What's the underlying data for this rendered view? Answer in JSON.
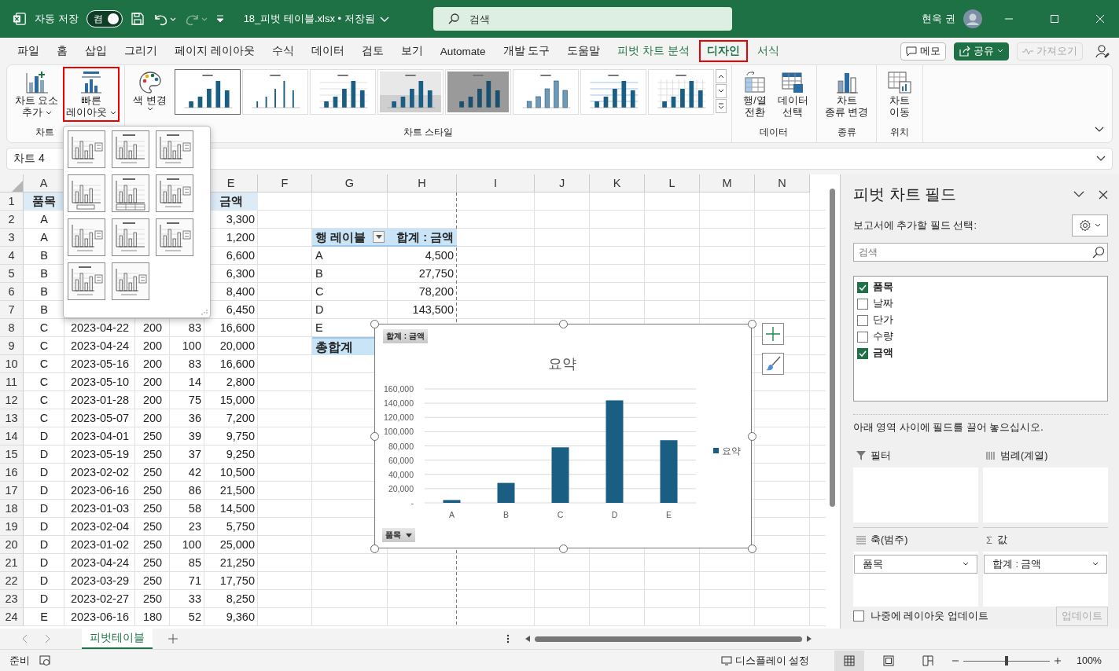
{
  "title_bar": {
    "autosave_label": "자동 저장",
    "autosave_state": "켬",
    "autosave_on": true,
    "redo_disabled": true,
    "filename": "18_피벗 테이블.xlsx • 저장됨",
    "search_placeholder": "검색",
    "user_name": "현욱 권"
  },
  "menu_tabs": [
    {
      "label": "파일",
      "selected": false,
      "contextual": false,
      "highlighted": false
    },
    {
      "label": "홈",
      "selected": false,
      "contextual": false,
      "highlighted": false
    },
    {
      "label": "삽입",
      "selected": false,
      "contextual": false,
      "highlighted": false
    },
    {
      "label": "그리기",
      "selected": false,
      "contextual": false,
      "highlighted": false
    },
    {
      "label": "페이지 레이아웃",
      "selected": false,
      "contextual": false,
      "highlighted": false
    },
    {
      "label": "수식",
      "selected": false,
      "contextual": false,
      "highlighted": false
    },
    {
      "label": "데이터",
      "selected": false,
      "contextual": false,
      "highlighted": false
    },
    {
      "label": "검토",
      "selected": false,
      "contextual": false,
      "highlighted": false
    },
    {
      "label": "보기",
      "selected": false,
      "contextual": false,
      "highlighted": false
    },
    {
      "label": "Automate",
      "selected": false,
      "contextual": false,
      "highlighted": false
    },
    {
      "label": "개발 도구",
      "selected": false,
      "contextual": false,
      "highlighted": false
    },
    {
      "label": "도움말",
      "selected": false,
      "contextual": false,
      "highlighted": false
    },
    {
      "label": "피벗 차트 분석",
      "selected": false,
      "contextual": true,
      "highlighted": false
    },
    {
      "label": "디자인",
      "selected": true,
      "contextual": true,
      "highlighted": true
    },
    {
      "label": "서식",
      "selected": false,
      "contextual": true,
      "highlighted": false
    }
  ],
  "tab_actions": {
    "comments": "메모",
    "share": "공유",
    "catch_up": "가져오기",
    "catch_up_disabled": true
  },
  "ribbon": [
    {
      "kind": "buttons",
      "label": "차트",
      "buttons": [
        {
          "lines": [
            "차트 요소",
            "추가"
          ],
          "dropdown": true,
          "highlighted": false
        },
        {
          "lines": [
            "빠른",
            "레이아웃"
          ],
          "dropdown": true,
          "highlighted": true
        }
      ]
    },
    {
      "kind": "gallery",
      "label": "차트 스타일",
      "buttons": [
        {
          "lines": [
            "색 변경"
          ],
          "dropdown": true,
          "highlighted": false
        }
      ],
      "styles": [
        {
          "kind": "plain",
          "selected": true
        },
        {
          "kind": "slim",
          "selected": false
        },
        {
          "kind": "striped",
          "selected": false
        },
        {
          "kind": "shadow",
          "selected": false
        },
        {
          "kind": "dark",
          "selected": false
        },
        {
          "kind": "outlined",
          "selected": false
        },
        {
          "kind": "gridded",
          "selected": false
        },
        {
          "kind": "hatched",
          "selected": false
        }
      ]
    },
    {
      "kind": "buttons",
      "label": "데이터",
      "buttons": [
        {
          "lines": [
            "행/열",
            "전환"
          ],
          "dropdown": false,
          "highlighted": false
        },
        {
          "lines": [
            "데이터",
            "선택"
          ],
          "dropdown": false,
          "highlighted": false
        }
      ]
    },
    {
      "kind": "buttons",
      "label": "종류",
      "buttons": [
        {
          "lines": [
            "차트",
            "종류 변경"
          ],
          "dropdown": false,
          "highlighted": false
        }
      ]
    },
    {
      "kind": "buttons",
      "label": "위치",
      "buttons": [
        {
          "lines": [
            "차트",
            "이동"
          ],
          "dropdown": false,
          "highlighted": false
        }
      ]
    }
  ],
  "name_box": "차트 4",
  "quick_layouts": [
    {
      "kind": "legend-right"
    },
    {
      "kind": "title"
    },
    {
      "kind": "title-legend-right"
    },
    {
      "kind": "legend-bottom"
    },
    {
      "kind": "title-table"
    },
    {
      "kind": "title-legend-right"
    },
    {
      "kind": "legend-right"
    },
    {
      "kind": "title"
    },
    {
      "kind": "title-legend-right"
    },
    {
      "kind": "title-legend-right"
    },
    {
      "kind": "legend-right"
    }
  ],
  "sheet": {
    "columns": [
      "A",
      "E",
      "F",
      "G",
      "H",
      "I",
      "J",
      "K",
      "L",
      "M",
      "N"
    ],
    "rows": [
      {
        "num": "1",
        "header": true,
        "a": "품목",
        "e": "금액"
      },
      {
        "num": "2",
        "header": false,
        "a": "A",
        "e": "3,300"
      },
      {
        "num": "3",
        "header": false,
        "a": "A",
        "e": "1,200"
      },
      {
        "num": "4",
        "header": false,
        "a": "B",
        "e": "6,600"
      },
      {
        "num": "5",
        "header": false,
        "a": "B",
        "e": "6,300"
      },
      {
        "num": "6",
        "header": false,
        "a": "B",
        "e": "8,400"
      },
      {
        "num": "7",
        "header": false,
        "a": "B",
        "e": "6,450"
      },
      {
        "num": "8",
        "header": false,
        "a": "C",
        "b": "2023-04-22",
        "c": "200",
        "d": "83",
        "e": "16,600"
      },
      {
        "num": "9",
        "header": false,
        "a": "C",
        "b": "2023-04-24",
        "c": "200",
        "d": "100",
        "e": "20,000"
      },
      {
        "num": "10",
        "header": false,
        "a": "C",
        "b": "2023-05-16",
        "c": "200",
        "d": "83",
        "e": "16,600"
      },
      {
        "num": "11",
        "header": false,
        "a": "C",
        "b": "2023-05-10",
        "c": "200",
        "d": "14",
        "e": "2,800"
      },
      {
        "num": "12",
        "header": false,
        "a": "C",
        "b": "2023-01-28",
        "c": "200",
        "d": "75",
        "e": "15,000"
      },
      {
        "num": "13",
        "header": false,
        "a": "C",
        "b": "2023-05-07",
        "c": "200",
        "d": "36",
        "e": "7,200"
      },
      {
        "num": "14",
        "header": false,
        "a": "D",
        "b": "2023-04-01",
        "c": "250",
        "d": "39",
        "e": "9,750"
      },
      {
        "num": "15",
        "header": false,
        "a": "D",
        "b": "2023-05-19",
        "c": "250",
        "d": "37",
        "e": "9,250"
      },
      {
        "num": "16",
        "header": false,
        "a": "D",
        "b": "2023-02-02",
        "c": "250",
        "d": "42",
        "e": "10,500"
      },
      {
        "num": "17",
        "header": false,
        "a": "D",
        "b": "2023-06-16",
        "c": "250",
        "d": "86",
        "e": "21,500"
      },
      {
        "num": "18",
        "header": false,
        "a": "D",
        "b": "2023-01-03",
        "c": "250",
        "d": "58",
        "e": "14,500"
      },
      {
        "num": "19",
        "header": false,
        "a": "D",
        "b": "2023-02-04",
        "c": "250",
        "d": "23",
        "e": "5,750"
      },
      {
        "num": "20",
        "header": false,
        "a": "D",
        "b": "2023-01-02",
        "c": "250",
        "d": "100",
        "e": "25,000"
      },
      {
        "num": "21",
        "header": false,
        "a": "D",
        "b": "2023-04-24",
        "c": "250",
        "d": "85",
        "e": "21,250"
      },
      {
        "num": "22",
        "header": false,
        "a": "D",
        "b": "2023-03-29",
        "c": "250",
        "d": "71",
        "e": "17,750"
      },
      {
        "num": "23",
        "header": false,
        "a": "D",
        "b": "2023-02-27",
        "c": "250",
        "d": "33",
        "e": "8,250"
      },
      {
        "num": "24",
        "header": false,
        "a": "E",
        "b": "2023-06-16",
        "c": "180",
        "d": "52",
        "e": "9,360"
      }
    ]
  },
  "pivot": {
    "row_label": "행 레이블",
    "value_label": "합계 : 금액",
    "rows": [
      {
        "label": "A",
        "value": "4,500"
      },
      {
        "label": "B",
        "value": "27,750"
      },
      {
        "label": "C",
        "value": "78,200"
      },
      {
        "label": "D",
        "value": "143,500"
      },
      {
        "label": "E"
      }
    ],
    "total_label": "총합계"
  },
  "chart": {
    "value_field_button": "합계 : 금액",
    "axis_field_button": "품목",
    "chart_data": {
      "type": "bar",
      "title": "요약",
      "categories": [
        "A",
        "B",
        "C",
        "D",
        "E"
      ],
      "grid": true,
      "series": [
        {
          "name": "요약",
          "color": "#1b5e83",
          "values": [
            4000,
            28000,
            78000,
            144000,
            88000
          ]
        }
      ],
      "ylim": [
        0,
        160000
      ],
      "yticks": [
        {
          "value": 0,
          "label": "-"
        },
        {
          "value": 20000,
          "label": "20,000"
        },
        {
          "value": 40000,
          "label": "40,000"
        },
        {
          "value": 60000,
          "label": "60,000"
        },
        {
          "value": 80000,
          "label": "80,000"
        },
        {
          "value": 100000,
          "label": "100,000"
        },
        {
          "value": 120000,
          "label": "120,000"
        },
        {
          "value": 140000,
          "label": "140,000"
        },
        {
          "value": 160000,
          "label": "160,000"
        }
      ]
    }
  },
  "field_pane": {
    "title": "피벗 차트 필드",
    "subtitle": "보고서에 추가할 필드 선택:",
    "search_placeholder": "검색",
    "fields": [
      {
        "label": "품목",
        "checked": true
      },
      {
        "label": "날짜",
        "checked": false
      },
      {
        "label": "단가",
        "checked": false
      },
      {
        "label": "수량",
        "checked": false
      },
      {
        "label": "금액",
        "checked": true
      }
    ],
    "hint": "아래 영역 사이에 필드를 끌어 놓으십시오.",
    "areas": [
      {
        "kind": "filter",
        "label": "필터"
      },
      {
        "kind": "legend",
        "label": "범례(계열)"
      },
      {
        "kind": "axis",
        "label": "축(범주)",
        "items": [
          "품목"
        ]
      },
      {
        "kind": "values",
        "symbol": "Σ",
        "label": "값",
        "items": [
          "합계 : 금액"
        ]
      }
    ],
    "defer_label": "나중에 레이아웃 업데이트",
    "defer_checked": false,
    "update_button": "업데이트",
    "update_disabled": true
  },
  "sheet_tabs": [
    {
      "label": "피벗테이블",
      "selected": true
    }
  ],
  "status_bar": {
    "ready": "준비",
    "display_settings": "디스플레이 설정",
    "views": [
      {
        "kind": "normal",
        "selected": true
      },
      {
        "kind": "page-layout",
        "selected": false
      },
      {
        "kind": "page-break",
        "selected": false
      }
    ],
    "zoom": {
      "level": 0.5,
      "reading": "100%"
    }
  }
}
